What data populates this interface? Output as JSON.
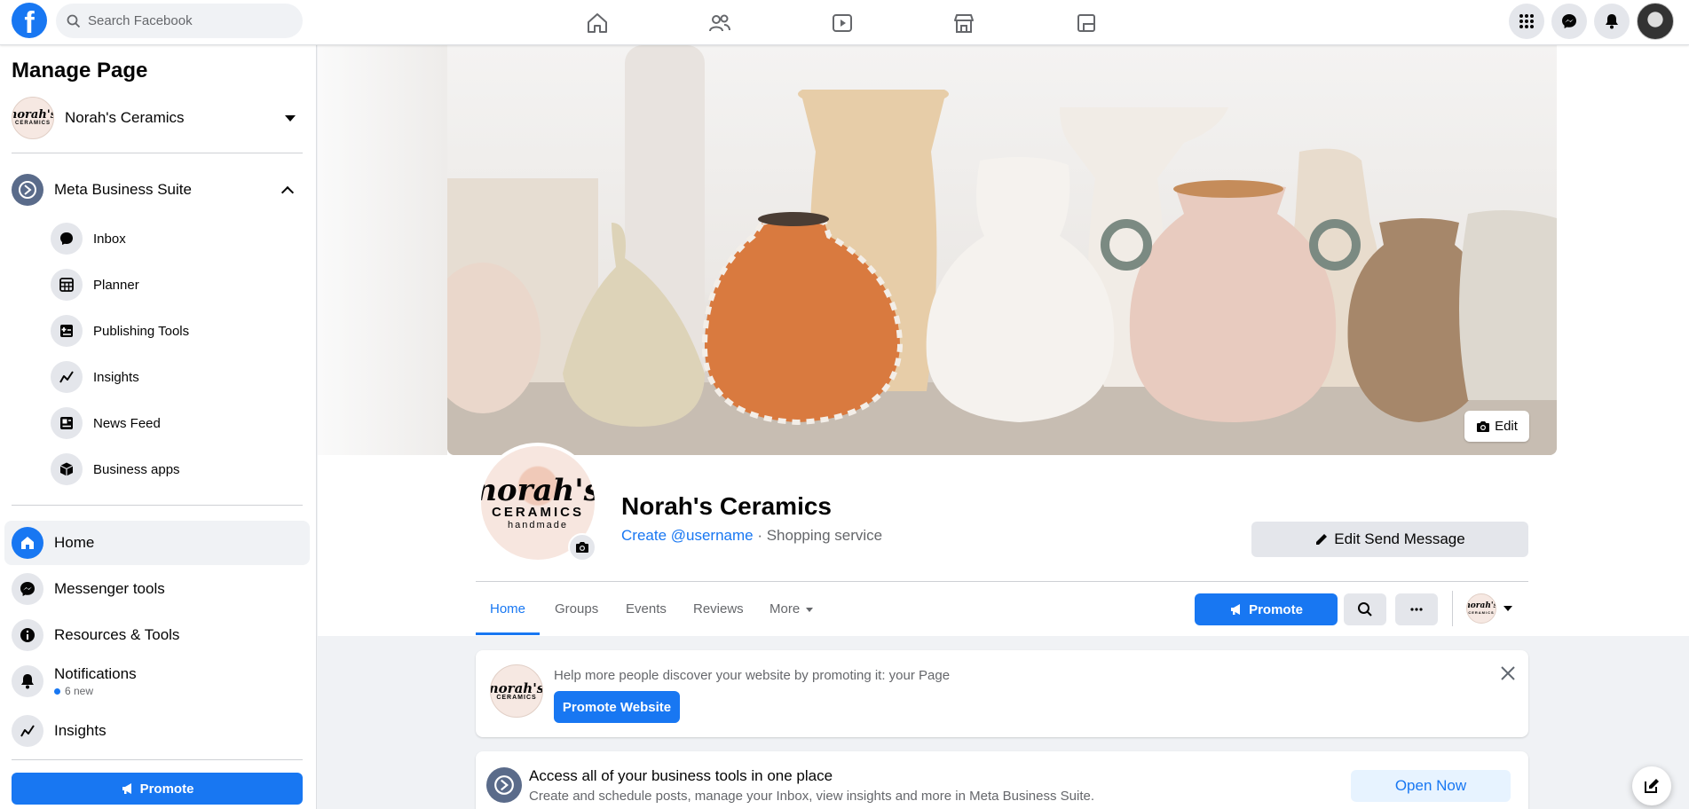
{
  "topbar": {
    "logo": "f",
    "search_placeholder": "Search Facebook",
    "nav_icons": [
      "home-icon",
      "friends-icon",
      "watch-icon",
      "marketplace-icon",
      "gaming-icon"
    ],
    "right_icons": [
      "menu-grid-icon",
      "messenger-icon",
      "notifications-icon"
    ]
  },
  "sidebar": {
    "title": "Manage Page",
    "page_name": "Norah's Ceramics",
    "logo_text_1": "norah's",
    "logo_text_2": "CERAMICS",
    "logo_text_3": "handmade",
    "mbs_label": "Meta Business Suite",
    "sub_items": [
      {
        "label": "Inbox",
        "icon": "inbox-icon"
      },
      {
        "label": "Planner",
        "icon": "planner-icon"
      },
      {
        "label": "Publishing Tools",
        "icon": "publishing-tools-icon"
      },
      {
        "label": "Insights",
        "icon": "insights-icon"
      },
      {
        "label": "News Feed",
        "icon": "news-feed-icon"
      },
      {
        "label": "Business apps",
        "icon": "business-apps-icon"
      }
    ],
    "main_items": [
      {
        "label": "Home",
        "icon": "home-icon",
        "active": true
      },
      {
        "label": "Messenger tools",
        "icon": "messenger-icon"
      },
      {
        "label": "Resources & Tools",
        "icon": "info-icon"
      },
      {
        "label": "Notifications",
        "icon": "bell-icon",
        "sub": "6 new"
      },
      {
        "label": "Insights",
        "icon": "insights-icon"
      }
    ],
    "promote_label": "Promote"
  },
  "cover": {
    "edit_label": "Edit"
  },
  "profile": {
    "name": "Norah's Ceramics",
    "username_link": "Create @username",
    "separator": " · ",
    "category": "Shopping service",
    "edit_send_label": "Edit Send Message"
  },
  "tabs": [
    {
      "label": "Home",
      "active": true
    },
    {
      "label": "Groups"
    },
    {
      "label": "Events"
    },
    {
      "label": "Reviews"
    },
    {
      "label": "More"
    }
  ],
  "actions": {
    "promote_label": "Promote"
  },
  "promo_card": {
    "text": "Help more people discover your website by promoting it: your Page",
    "button_label": "Promote Website"
  },
  "mbs_card": {
    "title": "Access all of your business tools in one place",
    "subtitle": "Create and schedule posts, manage your Inbox, view insights and more in Meta Business Suite.",
    "button_label": "Open Now"
  },
  "colors": {
    "brand_blue": "#1877f2",
    "background": "#f0f2f5",
    "secondary_text": "#65676b"
  }
}
